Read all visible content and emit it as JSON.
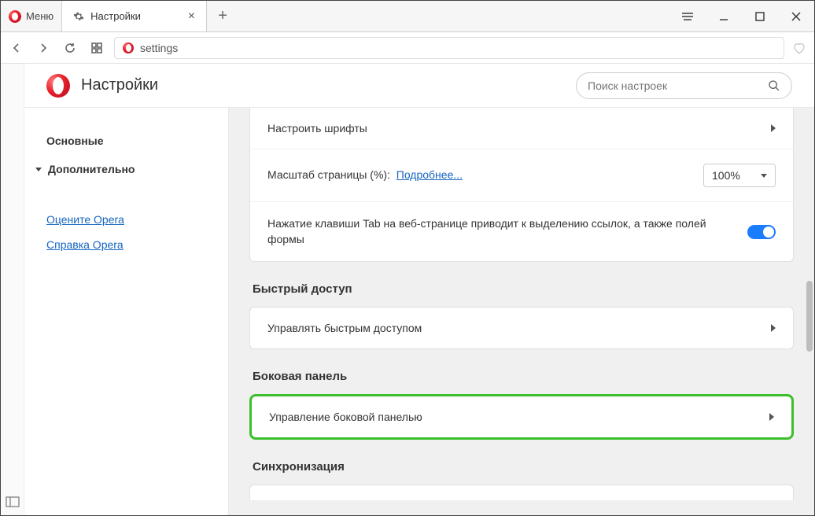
{
  "menu_label": "Меню",
  "tab": {
    "title": "Настройки"
  },
  "address": "settings",
  "header": {
    "title": "Настройки",
    "search_placeholder": "Поиск настроек"
  },
  "sidebar": {
    "basic": "Основные",
    "advanced": "Дополнительно",
    "rate": "Оцените Opera",
    "help": "Справка Opera"
  },
  "rows": {
    "fonts": "Настроить шрифты",
    "zoom_label": "Масштаб страницы (%):",
    "zoom_more": "Подробнее...",
    "zoom_value": "100%",
    "tab_highlight": "Нажатие клавиши Tab на веб-странице приводит к выделению ссылок, а также полей формы"
  },
  "sections": {
    "speed_dial_title": "Быстрый доступ",
    "speed_dial_manage": "Управлять быстрым доступом",
    "sidebar_title": "Боковая панель",
    "sidebar_manage": "Управление боковой панелью",
    "sync_title": "Синхронизация"
  }
}
